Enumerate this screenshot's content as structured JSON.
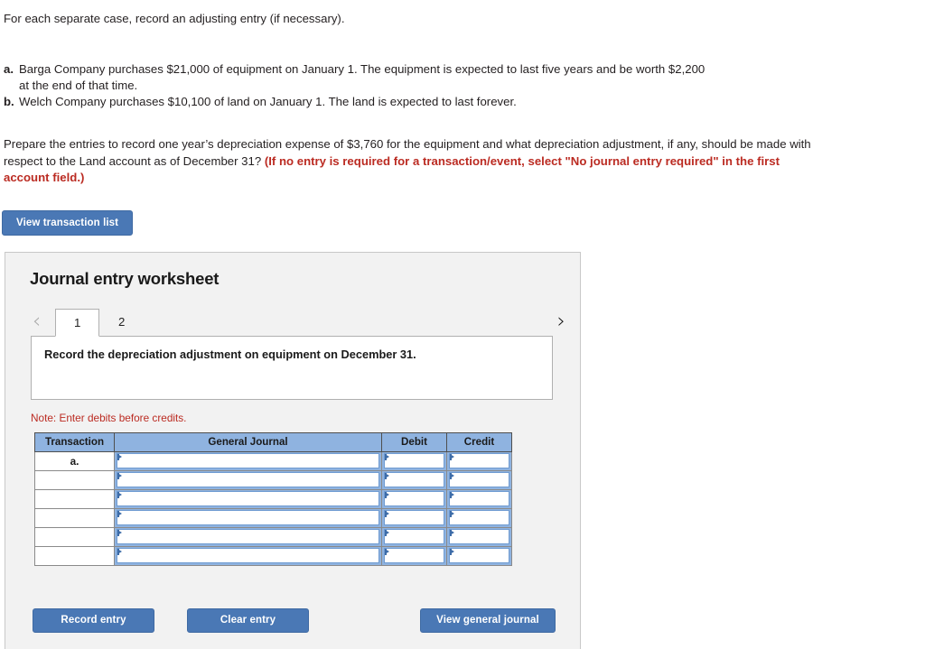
{
  "prompt": {
    "intro": "For each separate case, record an adjusting entry (if necessary).",
    "cases": [
      {
        "letter": "a.",
        "text": "Barga Company purchases $21,000 of equipment on January 1. The equipment is expected to last five years and be worth $2,200",
        "continuation": "at the end of that time."
      },
      {
        "letter": "b.",
        "text": "Welch Company purchases $10,100 of land on January 1. The land is expected to last forever.",
        "continuation": ""
      }
    ],
    "ask_plain": "Prepare the entries to record one year’s depreciation expense of $3,760 for the equipment and what depreciation adjustment, if any, should be made with respect to the Land account as of December 31? ",
    "ask_bold_red": "(If no entry is required for a transaction/event, select \"No journal entry required\" in the first account field.)"
  },
  "toolbar": {
    "view_transaction_list_label": "View transaction list"
  },
  "worksheet": {
    "title": "Journal entry worksheet",
    "nav": {
      "prev_icon": "chevron-left-icon",
      "next_icon": "chevron-right-icon",
      "prev_glyph": "‹",
      "next_glyph": "›"
    },
    "tabs": [
      {
        "label": "1",
        "active": true
      },
      {
        "label": "2",
        "active": false
      }
    ],
    "description": "Record the depreciation adjustment on equipment on December 31.",
    "note": "Note: Enter debits before credits.",
    "table": {
      "headers": [
        "Transaction",
        "General Journal",
        "Debit",
        "Credit"
      ],
      "rows": [
        {
          "transaction": "a.",
          "general_journal": "",
          "debit": "",
          "credit": ""
        },
        {
          "transaction": "",
          "general_journal": "",
          "debit": "",
          "credit": ""
        },
        {
          "transaction": "",
          "general_journal": "",
          "debit": "",
          "credit": ""
        },
        {
          "transaction": "",
          "general_journal": "",
          "debit": "",
          "credit": ""
        },
        {
          "transaction": "",
          "general_journal": "",
          "debit": "",
          "credit": ""
        },
        {
          "transaction": "",
          "general_journal": "",
          "debit": "",
          "credit": ""
        }
      ]
    },
    "actions": {
      "record_entry_label": "Record entry",
      "clear_entry_label": "Clear entry",
      "view_general_journal_label": "View general journal"
    }
  },
  "colors": {
    "button_blue": "#4a78b5",
    "table_header_blue": "#8fb3e0",
    "field_border_blue": "#6f9bd1",
    "marker_blue": "#3d6ca8",
    "alert_red": "#bb2b22",
    "panel_gray": "#f2f2f2"
  }
}
